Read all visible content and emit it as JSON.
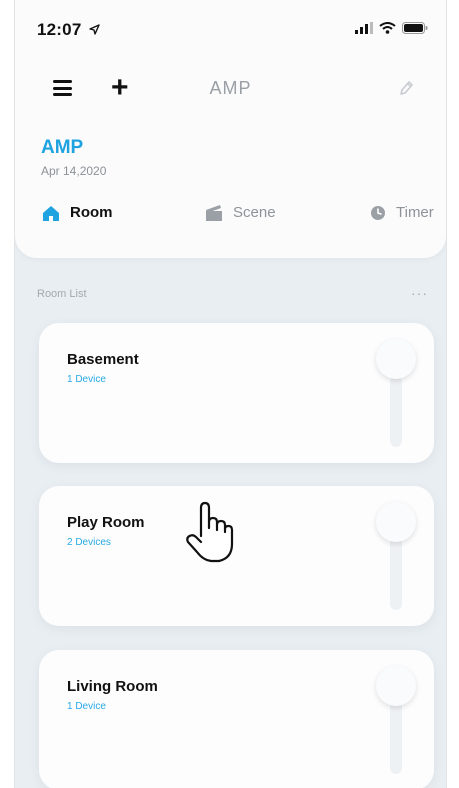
{
  "status_bar": {
    "time": "12:07",
    "location_icon": "location-arrow-icon",
    "signal_icon": "cellular-signal-icon",
    "wifi_icon": "wifi-icon",
    "battery_icon": "battery-icon"
  },
  "header": {
    "menu_icon": "hamburger-menu-icon",
    "add_icon": "plus-icon",
    "title": "AMP",
    "edit_icon": "pencil-icon"
  },
  "home": {
    "name": "AMP",
    "date": "Apr 14,2020"
  },
  "tabs": [
    {
      "label": "Room",
      "icon": "house-icon",
      "active": true
    },
    {
      "label": "Scene",
      "icon": "clapperboard-icon",
      "active": false
    },
    {
      "label": "Timer",
      "icon": "clock-icon",
      "active": false
    }
  ],
  "room_list": {
    "label": "Room List",
    "more_label": "···",
    "rooms": [
      {
        "name": "Basement",
        "devices": "1 Device"
      },
      {
        "name": "Play Room",
        "devices": "2 Devices"
      },
      {
        "name": "Living Room",
        "devices": "1 Device"
      }
    ]
  },
  "colors": {
    "accent": "#1fa3e0",
    "background": "#e9eef2",
    "panel": "#fbfbfc"
  }
}
